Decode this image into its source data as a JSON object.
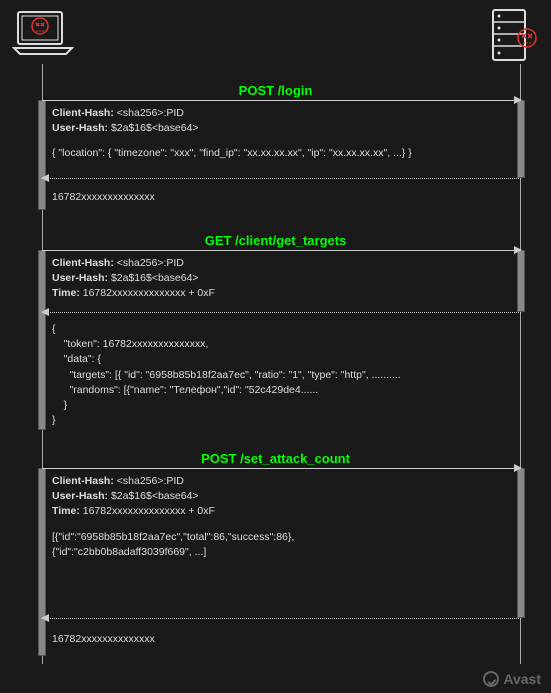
{
  "labels": {
    "msg1": "POST /login",
    "msg2": "GET /client/get_targets",
    "msg3": "POST /set_attack_count"
  },
  "block1": {
    "hdr1_key": "Client-Hash:",
    "hdr1_val": " <sha256>:PID",
    "hdr2_key": "User-Hash:",
    "hdr2_val": " $2a$16$<base64>",
    "body": "{  \"location\": { \"timezone\": \"xxx\", \"find_ip\": \"xx.xx.xx.xx\",  \"ip\": \"xx.xx.xx.xx\", ...} }"
  },
  "resp1": "16782xxxxxxxxxxxxxx",
  "block2": {
    "hdr1_key": "Client-Hash:",
    "hdr1_val": " <sha256>:PID",
    "hdr2_key": "User-Hash:",
    "hdr2_val": " $2a$16$<base64>",
    "hdr3_key": "Time:",
    "hdr3_val": " 16782xxxxxxxxxxxxxx + 0xF"
  },
  "resp2": "{\n    \"token\": 16782xxxxxxxxxxxxxx,\n    \"data\": {\n      \"targets\": [{ \"id\": \"6958b85b18f2aa7ec\", \"ratio\": \"1\", \"type\": \"http\", ..........\n      \"randoms\": [{\"name\": \"Телефон\",\"id\": \"52c429de4......\n    }\n}",
  "block3": {
    "hdr1_key": "Client-Hash:",
    "hdr1_val": " <sha256>:PID",
    "hdr2_key": "User-Hash:",
    "hdr2_val": " $2a$16$<base64>",
    "hdr3_key": "Time:",
    "hdr3_val": " 16782xxxxxxxxxxxxxx + 0xF",
    "body1": "[{\"id\":\"6958b85b18f2aa7ec\",\"total\":86,\"success\":86},",
    "body2": "{\"id\":\"c2bb0b8adaff3039f669\", ...]"
  },
  "resp3": "16782xxxxxxxxxxxxxx",
  "footer": "Avast"
}
